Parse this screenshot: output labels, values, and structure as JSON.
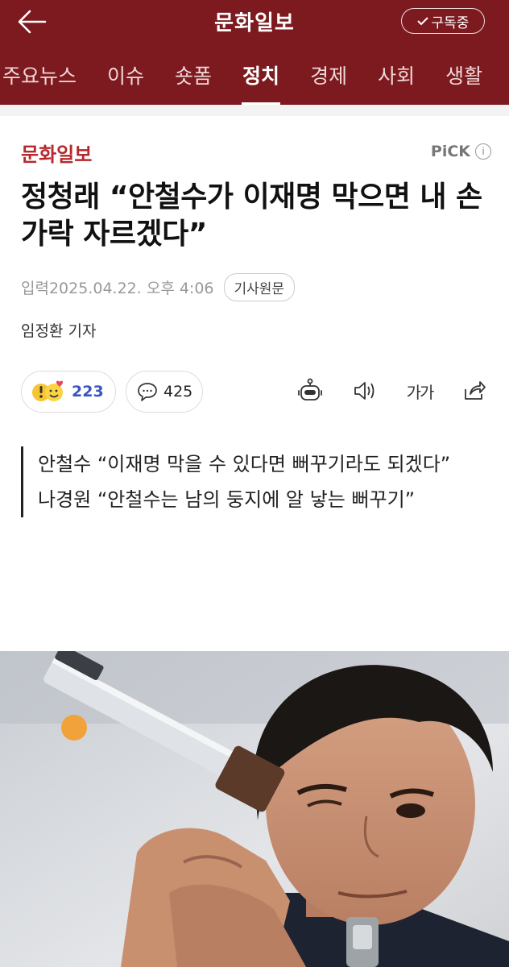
{
  "header": {
    "title": "문화일보",
    "subscribe_label": "구독중",
    "tabs": [
      {
        "label": "주요뉴스"
      },
      {
        "label": "이슈"
      },
      {
        "label": "숏폼"
      },
      {
        "label": "정치",
        "active": true
      },
      {
        "label": "경제"
      },
      {
        "label": "사회"
      },
      {
        "label": "생활"
      }
    ]
  },
  "article": {
    "source": "문화일보",
    "pick_label": "PiCK",
    "headline": "정청래 “안철수가 이재명 막으면 내 손가락 자르겠다”",
    "input_label": "입력",
    "date": "2025.04.22. 오후 4:06",
    "original_button": "기사원문",
    "byline": "임정환 기자",
    "reactions_count": "223",
    "comments_count": "425",
    "font_button": "가가",
    "summary": [
      "안철수 “이재명 막을 수 있다면 뻐꾸기라도 되겠다”",
      "나경원 “안철수는 남의 둥지에 알 낳는 뻐꾸기”"
    ]
  },
  "colors": {
    "brand_bar": "#7c1a1f",
    "source_red": "#b5282e",
    "reaction_blue": "#3a55c0"
  },
  "icons": [
    "back-arrow-icon",
    "checkmark-icon",
    "info-icon",
    "emoji-reaction-icon",
    "comment-bubble-icon",
    "robot-summary-icon",
    "speaker-icon",
    "font-size-icon",
    "share-icon"
  ]
}
